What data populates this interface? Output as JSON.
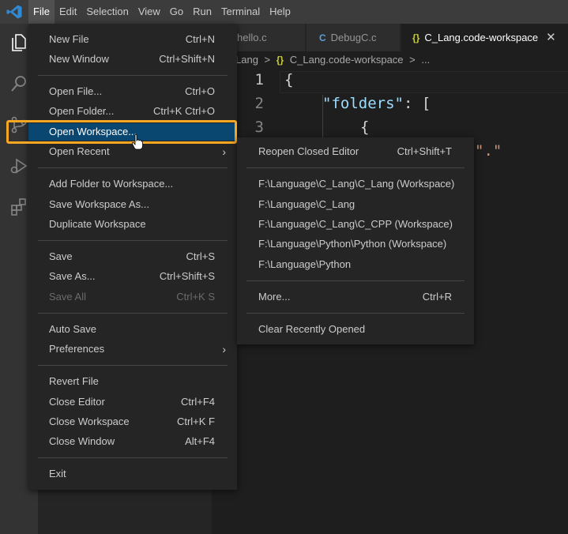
{
  "menubar": {
    "items": [
      "File",
      "Edit",
      "Selection",
      "View",
      "Go",
      "Run",
      "Terminal",
      "Help"
    ],
    "active": "File"
  },
  "tabs": [
    {
      "label": "hello.c",
      "icon": "C"
    },
    {
      "label": "DebugC.c",
      "icon": "C"
    },
    {
      "label": "C_Lang.code-workspace",
      "icon": "{}",
      "close": "✕"
    }
  ],
  "breadcrumb": {
    "part1": "Lang",
    "sep1": ">",
    "icon": "{}",
    "part2": "C_Lang.code-workspace",
    "sep2": ">",
    "part3": "..."
  },
  "editor": {
    "line_numbers": [
      "1",
      "2",
      "3"
    ],
    "lines": {
      "l1": "{",
      "l2_key": "\"folders\"",
      "l2_rest": ": [",
      "l3": "{",
      "l4_val": "\".\""
    }
  },
  "file_menu": {
    "new_file": {
      "label": "New File",
      "key": "Ctrl+N"
    },
    "new_window": {
      "label": "New Window",
      "key": "Ctrl+Shift+N"
    },
    "open_file": {
      "label": "Open File...",
      "key": "Ctrl+O"
    },
    "open_folder": {
      "label": "Open Folder...",
      "key": "Ctrl+K Ctrl+O"
    },
    "open_workspace": {
      "label": "Open Workspace..."
    },
    "open_recent": {
      "label": "Open Recent",
      "arrow": "›"
    },
    "add_folder": {
      "label": "Add Folder to Workspace..."
    },
    "save_workspace_as": {
      "label": "Save Workspace As..."
    },
    "duplicate_workspace": {
      "label": "Duplicate Workspace"
    },
    "save": {
      "label": "Save",
      "key": "Ctrl+S"
    },
    "save_as": {
      "label": "Save As...",
      "key": "Ctrl+Shift+S"
    },
    "save_all": {
      "label": "Save All",
      "key": "Ctrl+K S"
    },
    "auto_save": {
      "label": "Auto Save"
    },
    "preferences": {
      "label": "Preferences",
      "arrow": "›"
    },
    "revert_file": {
      "label": "Revert File"
    },
    "close_editor": {
      "label": "Close Editor",
      "key": "Ctrl+F4"
    },
    "close_workspace": {
      "label": "Close Workspace",
      "key": "Ctrl+K F"
    },
    "close_window": {
      "label": "Close Window",
      "key": "Alt+F4"
    },
    "exit": {
      "label": "Exit"
    }
  },
  "recent_menu": {
    "reopen": {
      "label": "Reopen Closed Editor",
      "key": "Ctrl+Shift+T"
    },
    "entries": [
      "F:\\Language\\C_Lang\\C_Lang (Workspace)",
      "F:\\Language\\C_Lang",
      "F:\\Language\\C_Lang\\C_CPP (Workspace)",
      "F:\\Language\\Python\\Python (Workspace)",
      "F:\\Language\\Python"
    ],
    "more": {
      "label": "More...",
      "key": "Ctrl+R"
    },
    "clear": {
      "label": "Clear Recently Opened"
    }
  },
  "colors": {
    "highlight_border": "#f5a623",
    "selection": "#094771",
    "menu_bg": "#252526"
  }
}
